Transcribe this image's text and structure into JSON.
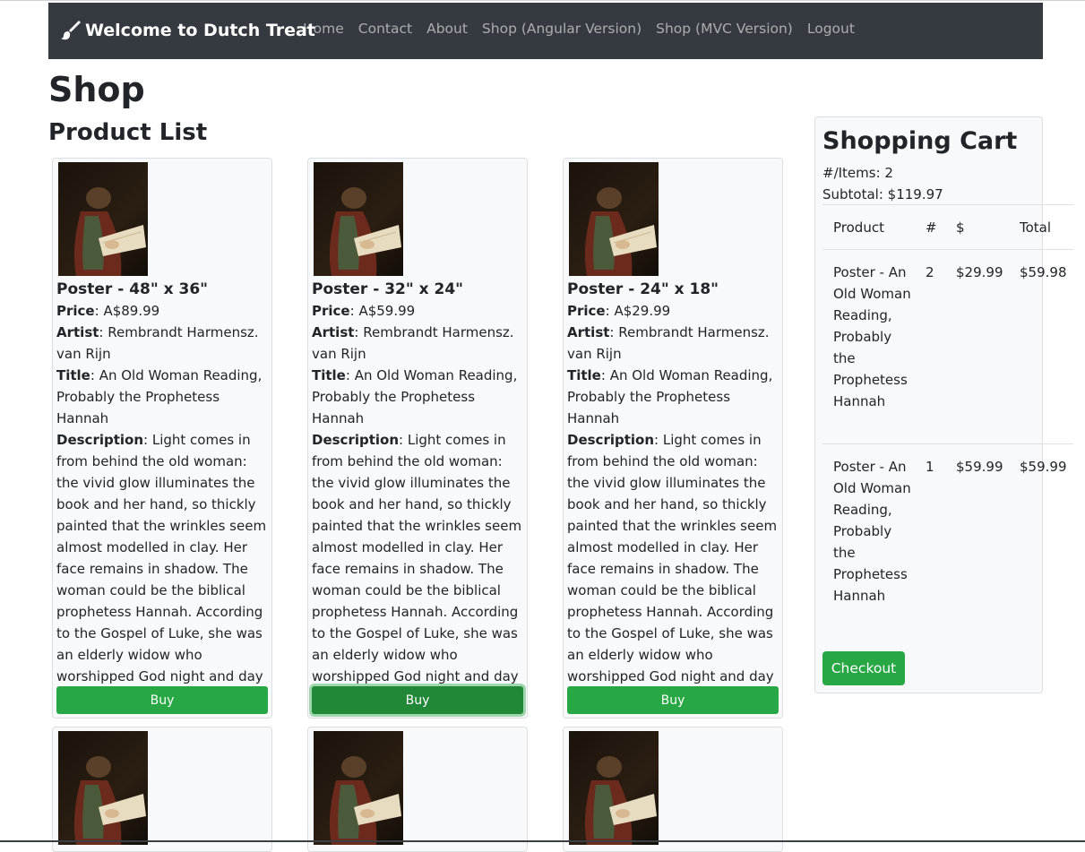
{
  "nav": {
    "brand": "Welcome to Dutch Treat",
    "brand_icon": "paint-brush-icon",
    "links": [
      "Home",
      "Contact",
      "About",
      "Shop (Angular Version)",
      "Shop (MVC Version)",
      "Logout"
    ]
  },
  "page": {
    "title": "Shop",
    "section_title": "Product List"
  },
  "product_labels": {
    "price": "Price",
    "artist": "Artist",
    "title": "Title",
    "description": "Description",
    "buy": "Buy"
  },
  "products": [
    {
      "name": "Poster - 48\" x 36\"",
      "price": "A$89.99",
      "artist": "Rembrandt Harmensz. van Rijn",
      "title": "An Old Woman Reading, Probably the Prophetess Hannah",
      "description": "Light comes in from behind the old woman: the vivid glow illuminates the book and her hand, so thickly painted that the wrinkles seem almost modelled in clay. Her face remains in shadow. The woman could be the biblical prophetess Hannah. According to the Gospel of Luke, she was an elderly widow who worshipped God night and day with fasting and prayer."
    },
    {
      "name": "Poster - 32\" x 24\"",
      "price": "A$59.99",
      "artist": "Rembrandt Harmensz. van Rijn",
      "title": "An Old Woman Reading, Probably the Prophetess Hannah",
      "description": "Light comes in from behind the old woman: the vivid glow illuminates the book and her hand, so thickly painted that the wrinkles seem almost modelled in clay. Her face remains in shadow. The woman could be the biblical prophetess Hannah. According to the Gospel of Luke, she was an elderly widow who worshipped God night and day with fasting and prayer."
    },
    {
      "name": "Poster - 24\" x 18\"",
      "price": "A$29.99",
      "artist": "Rembrandt Harmensz. van Rijn",
      "title": "An Old Woman Reading, Probably the Prophetess Hannah",
      "description": "Light comes in from behind the old woman: the vivid glow illuminates the book and her hand, so thickly painted that the wrinkles seem almost modelled in clay. Her face remains in shadow. The woman could be the biblical prophetess Hannah. According to the Gospel of Luke, she was an elderly widow who worshipped God night and day with fasting and prayer."
    }
  ],
  "cart": {
    "title": "Shopping Cart",
    "items_text": "#/Items: 2",
    "subtotal_text": "Subtotal: $119.97",
    "columns": [
      "Product",
      "#",
      "$",
      "Total"
    ],
    "rows": [
      {
        "product": "Poster - An Old Woman Reading, Probably the Prophetess Hannah",
        "qty": "2",
        "price": "$29.99",
        "total": "$59.98"
      },
      {
        "product": "Poster - An Old Woman Reading, Probably the Prophetess Hannah",
        "qty": "1",
        "price": "$59.99",
        "total": "$59.99"
      }
    ],
    "checkout": "Checkout"
  },
  "colors": {
    "navbar": "#343a40",
    "success": "#28a745",
    "card_bg": "#f8f9fa"
  }
}
